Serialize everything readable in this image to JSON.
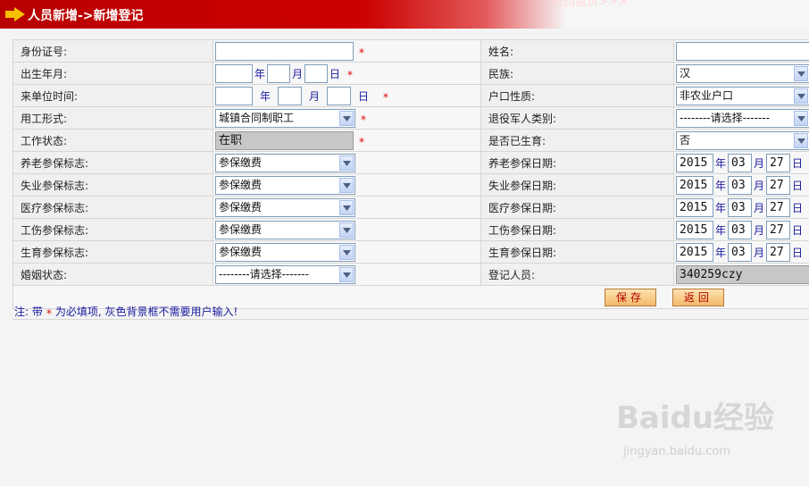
{
  "header": {
    "title": "人员新增->新增登记",
    "cutoff_text": "返回首页>>>"
  },
  "form": {
    "id_card": {
      "label": "身份证号:",
      "value": ""
    },
    "name": {
      "label": "姓名:",
      "value": ""
    },
    "birth": {
      "label": "出生年月:",
      "year": "",
      "month": "",
      "day": "",
      "year_unit": "年",
      "month_unit": "月",
      "day_unit": "日"
    },
    "ethnic": {
      "label": "民族:",
      "value": "汉"
    },
    "join_date": {
      "label": "来单位时间:",
      "year": "",
      "month": "",
      "day": "",
      "year_unit": "年",
      "month_unit": "月",
      "day_unit": "日"
    },
    "hukou": {
      "label": "户口性质:",
      "value": "非农业户口"
    },
    "employment": {
      "label": "用工形式:",
      "value": "城镇合同制职工"
    },
    "veteran": {
      "label": "退役军人类别:",
      "value": "--------请选择-------"
    },
    "work_status": {
      "label": "工作状态:",
      "value": "在职"
    },
    "childbirth": {
      "label": "是否已生育:",
      "value": "否"
    },
    "pension": {
      "label": "养老参保标志:",
      "value": "参保缴费",
      "date_label": "养老参保日期:",
      "year": "2015",
      "month": "03",
      "day": "27"
    },
    "unemployment": {
      "label": "失业参保标志:",
      "value": "参保缴费",
      "date_label": "失业参保日期:",
      "year": "2015",
      "month": "03",
      "day": "27"
    },
    "medical": {
      "label": "医疗参保标志:",
      "value": "参保缴费",
      "date_label": "医疗参保日期:",
      "year": "2015",
      "month": "03",
      "day": "27"
    },
    "injury": {
      "label": "工伤参保标志:",
      "value": "参保缴费",
      "date_label": "工伤参保日期:",
      "year": "2015",
      "month": "03",
      "day": "27"
    },
    "maternity": {
      "label": "生育参保标志:",
      "value": "参保缴费",
      "date_label": "生育参保日期:",
      "year": "2015",
      "month": "03",
      "day": "27"
    },
    "marital": {
      "label": "婚姻状态:",
      "value": "--------请选择-------"
    },
    "registrar": {
      "label": "登记人员:",
      "value": "340259czy"
    },
    "units": {
      "year": "年",
      "month": "月",
      "day": "日"
    },
    "required_mark": "*"
  },
  "buttons": {
    "save": "保存",
    "back": "返回"
  },
  "note": {
    "prefix": "注: 带",
    "star": "*",
    "suffix": "为必填项, 灰色背景框不需要用户输入!"
  },
  "watermark": {
    "logo": "Baidu经验",
    "sub": "jingyan.baidu.com"
  },
  "colors": {
    "banner_red": "#cc0000",
    "required": "#e00000",
    "unit_blue": "#1a1aa0",
    "readonly_gray": "#c8c8c8"
  }
}
